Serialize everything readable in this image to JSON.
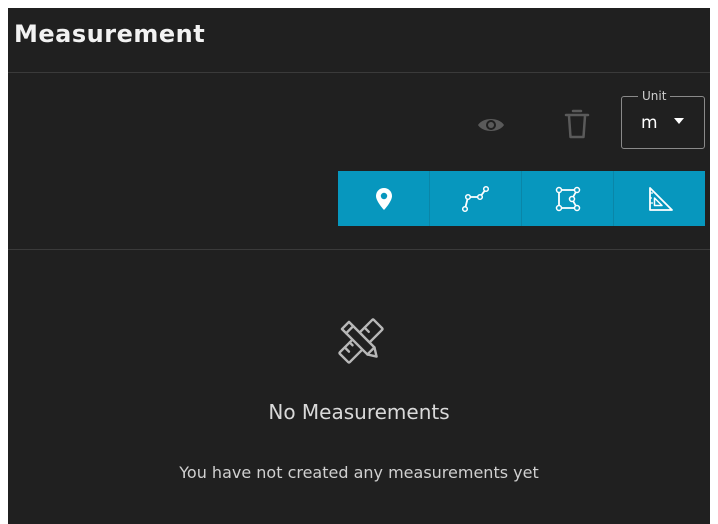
{
  "panel": {
    "title": "Measurement"
  },
  "controls": {
    "unit_label": "Unit",
    "unit_value": "m"
  },
  "tools": [
    {
      "icon": "location-pin-icon",
      "active": true
    },
    {
      "icon": "polyline-icon",
      "active": false
    },
    {
      "icon": "polygon-area-icon",
      "active": false
    },
    {
      "icon": "triangle-ruler-icon",
      "active": false
    }
  ],
  "empty_state": {
    "icon": "pencil-ruler-icon",
    "title": "No Measurements",
    "message": "You have not created any measurements yet"
  },
  "colors": {
    "panel_bg": "#202020",
    "toolbar_accent": "#0797be",
    "text": "#e6e6e6"
  }
}
